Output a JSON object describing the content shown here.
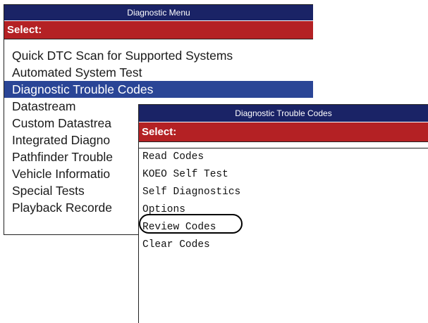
{
  "colors": {
    "title_bar": "#1a2366",
    "select_bar": "#b42124",
    "selected_row": "#2a4596",
    "highlight_oval": "#000000"
  },
  "main_window": {
    "title": "Diagnostic Menu",
    "select_label": "Select:",
    "items": [
      {
        "label": "Quick DTC Scan for Supported Systems",
        "selected": false
      },
      {
        "label": "Automated System Test",
        "selected": false
      },
      {
        "label": "Diagnostic Trouble Codes",
        "selected": true
      },
      {
        "label": "Datastream",
        "selected": false
      },
      {
        "label": "Custom Datastrea",
        "selected": false
      },
      {
        "label": "Integrated Diagno",
        "selected": false
      },
      {
        "label": "Pathfinder Trouble",
        "selected": false
      },
      {
        "label": "Vehicle Informatio",
        "selected": false
      },
      {
        "label": "Special Tests",
        "selected": false
      },
      {
        "label": "Playback Recorde",
        "selected": false
      }
    ]
  },
  "sub_window": {
    "title": "Diagnostic Trouble Codes",
    "select_label": "Select:",
    "items": [
      {
        "label": "Read Codes"
      },
      {
        "label": "KOEO Self Test"
      },
      {
        "label": "Self Diagnostics"
      },
      {
        "label": "Options"
      },
      {
        "label": "Review Codes",
        "circled": true
      },
      {
        "label": "Clear Codes"
      }
    ]
  }
}
